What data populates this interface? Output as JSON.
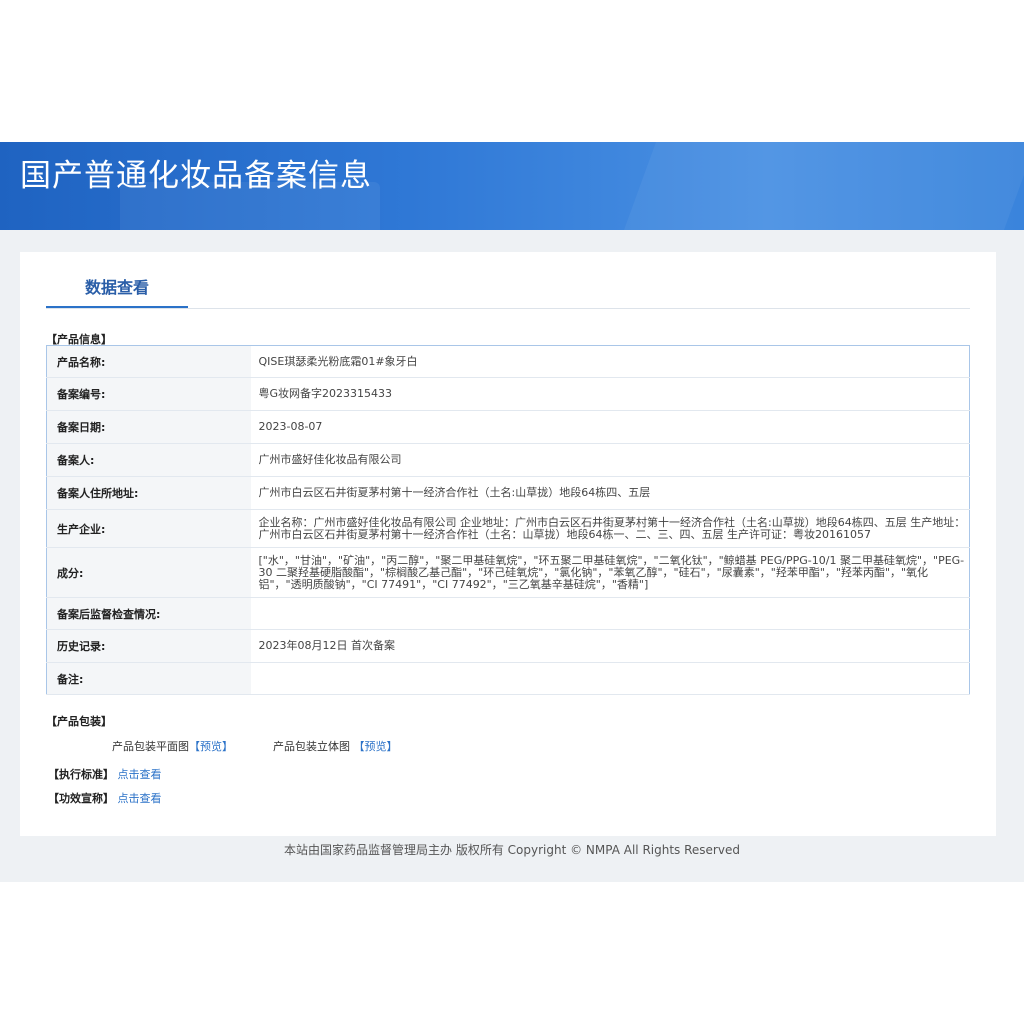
{
  "page": {
    "title": "国产普通化妆品备案信息",
    "tab_label": "数据查看",
    "footer": "本站由国家药品监督管理局主办 版权所有 Copyright © NMPA All Rights Reserved"
  },
  "product_info": {
    "section_label": "【产品信息】",
    "rows": [
      {
        "label": "产品名称:",
        "value": "QISE琪瑟柔光粉底霜01#象牙白"
      },
      {
        "label": "备案编号:",
        "value": "粤G妆网备字2023315433"
      },
      {
        "label": "备案日期:",
        "value": "2023-08-07"
      },
      {
        "label": "备案人:",
        "value": "广州市盛好佳化妆品有限公司"
      },
      {
        "label": "备案人住所地址:",
        "value": "广州市白云区石井街夏茅村第十一经济合作社（土名:山草拢）地段64栋四、五层"
      },
      {
        "label": "生产企业:",
        "value": "企业名称：广州市盛好佳化妆品有限公司 企业地址：广州市白云区石井街夏茅村第十一经济合作社（土名:山草拢）地段64栋四、五层 生产地址：广州市白云区石井街夏茅村第十一经济合作社（土名：山草拢）地段64栋一、二、三、四、五层 生产许可证：粤妆20161057"
      },
      {
        "label": "成分:",
        "value": "[\"水\"，\"甘油\"，\"矿油\"，\"丙二醇\"，\"聚二甲基硅氧烷\"，\"环五聚二甲基硅氧烷\"，\"二氧化钛\"，\"鲸蜡基 PEG/PPG-10/1 聚二甲基硅氧烷\"，\"PEG-30 二聚羟基硬脂酸酯\"，\"棕榈酸乙基己酯\"，\"环己硅氧烷\"，\"氯化钠\"，\"苯氧乙醇\"，\"硅石\"，\"尿囊素\"，\"羟苯甲酯\"，\"羟苯丙酯\"，\"氧化铝\"，\"透明质酸钠\"，\"CI 77491\"，\"CI 77492\"，\"三乙氧基辛基硅烷\"，\"香精\"]"
      },
      {
        "label": "备案后监督检查情况:",
        "value": ""
      },
      {
        "label": "历史记录:",
        "value": "2023年08月12日 首次备案"
      },
      {
        "label": "备注:",
        "value": ""
      }
    ]
  },
  "packaging": {
    "section_label": "【产品包装】",
    "flat_label": "产品包装平面图",
    "flat_link": "【预览】",
    "solid_label": "产品包装立体图",
    "solid_link": "【预览】"
  },
  "standard": {
    "label": "【执行标准】",
    "link": "点击查看"
  },
  "efficacy": {
    "label": "【功效宣称】",
    "link": "点击查看"
  }
}
